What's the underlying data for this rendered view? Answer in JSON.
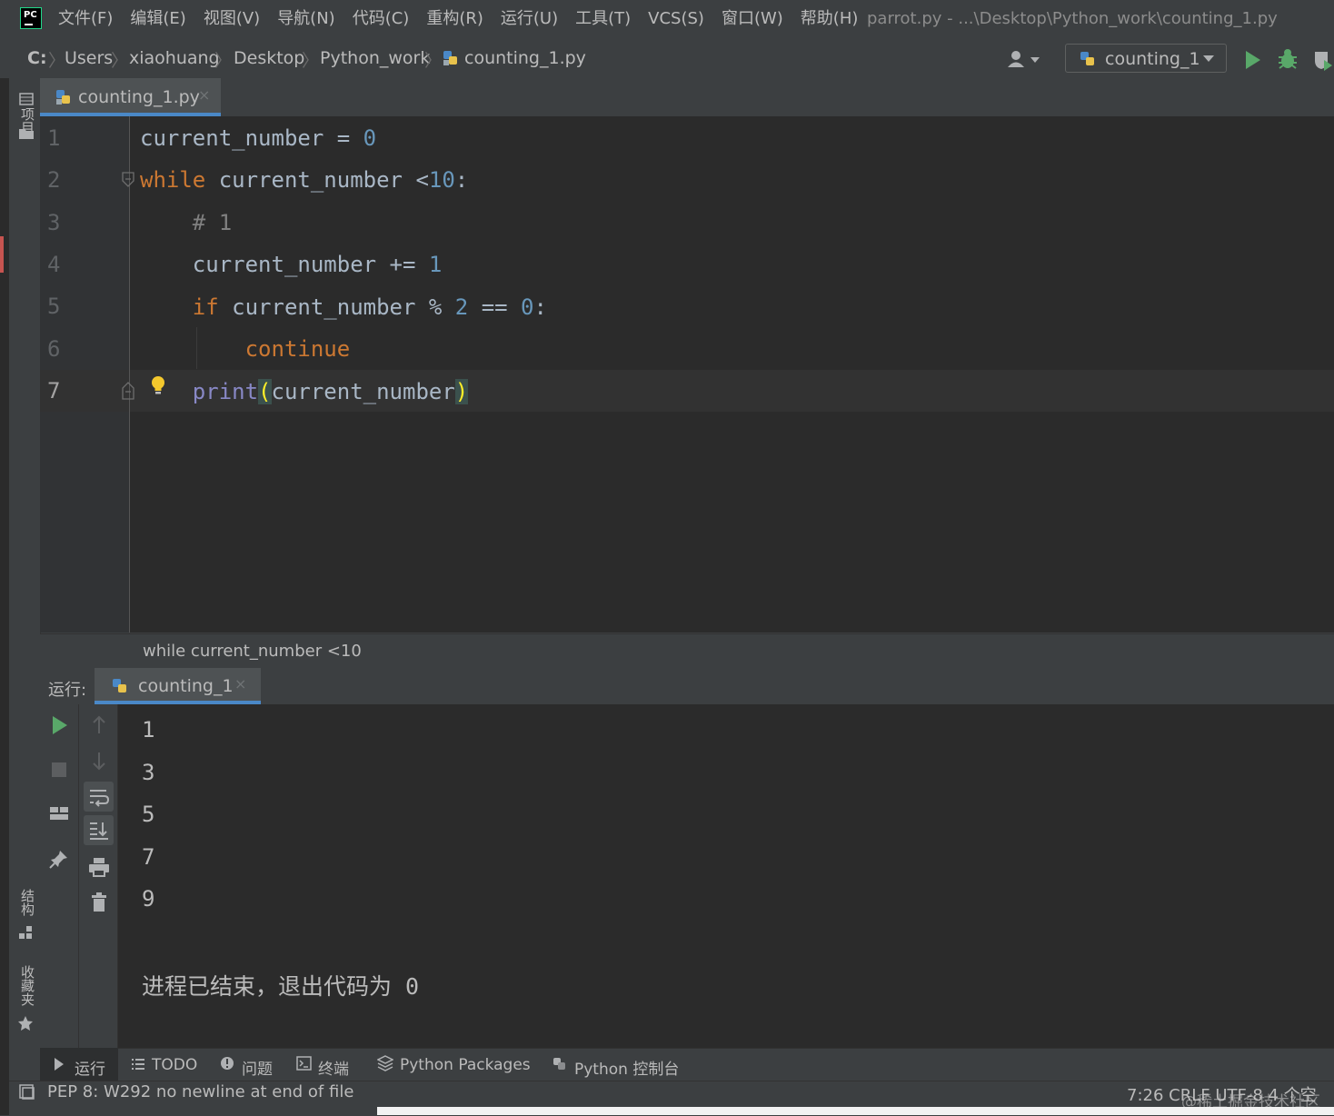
{
  "app": {
    "logo_text": "PC",
    "window_title": "parrot.py - ...\\Desktop\\Python_work\\counting_1.py"
  },
  "menu": [
    "文件(F)",
    "编辑(E)",
    "视图(V)",
    "导航(N)",
    "代码(C)",
    "重构(R)",
    "运行(U)",
    "工具(T)",
    "VCS(S)",
    "窗口(W)",
    "帮助(H)"
  ],
  "breadcrumb": [
    "C:",
    "Users",
    "xiaohuang",
    "Desktop",
    "Python_work",
    "counting_1.py"
  ],
  "run_config": {
    "label": "counting_1"
  },
  "left_strip": {
    "project_label": "项目",
    "structure_label": "结构",
    "favorites_label": "收藏夹"
  },
  "editor_tab": {
    "label": "counting_1.py",
    "close": "×"
  },
  "code": {
    "line_numbers": [
      "1",
      "2",
      "3",
      "4",
      "5",
      "6",
      "7"
    ],
    "lines": [
      "current_number = 0",
      "while current_number <10:",
      "    # 1",
      "    current_number += 1",
      "    if current_number % 2 == 0:",
      "        continue",
      "    print(current_number)"
    ],
    "current_line": 7
  },
  "code_breadcrumb": "while current_number <10",
  "run_panel": {
    "prefix": "运行:",
    "tab_label": "counting_1",
    "tab_close": "×",
    "output": [
      "1",
      "3",
      "5",
      "7",
      "9"
    ],
    "exit_message": "进程已结束，退出代码为 0"
  },
  "bottom_tabs": [
    "运行",
    "TODO",
    "问题",
    "终端",
    "Python Packages",
    "Python 控制台"
  ],
  "status": {
    "message": "PEP 8: W292 no newline at end of file",
    "right": "7:26   CRLF   UTF-8   4 个空",
    "watermark": "@稀土掘金技术社区"
  },
  "colors": {
    "keyword": "#cc7832",
    "number": "#6897bb",
    "builtin": "#8888c6",
    "comment": "#808080",
    "run_green": "#59a869",
    "accent_blue": "#4a88c7"
  },
  "icons": [
    "pycharm-logo-icon",
    "python-file-icon",
    "user-icon",
    "run-icon",
    "debug-icon",
    "coverage-icon",
    "folder-icon",
    "lightbulb-icon",
    "stop-icon",
    "layout-icon",
    "pin-icon",
    "up-arrow-icon",
    "down-arrow-icon",
    "soft-wrap-icon",
    "scroll-end-icon",
    "print-icon",
    "trash-icon",
    "star-icon"
  ]
}
